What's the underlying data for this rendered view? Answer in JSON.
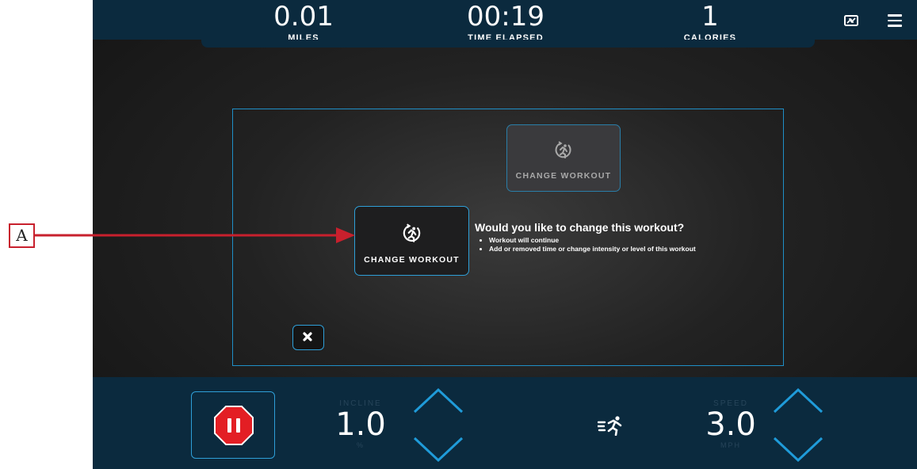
{
  "stats": {
    "miles": {
      "value": "0.01",
      "label": "MILES"
    },
    "time": {
      "value": "00:19",
      "label": "TIME ELAPSED"
    },
    "calories": {
      "value": "1",
      "label": "CALORIES"
    }
  },
  "dialog": {
    "ghost_card_label": "CHANGE WORKOUT",
    "main_card_label": "CHANGE WORKOUT",
    "question_title": "Would you like to change this workout?",
    "bullets": [
      "Workout will continue",
      "Add or removed time or change intensity or level of this workout"
    ]
  },
  "controls": {
    "incline": {
      "label": "INCLINE",
      "value": "1.0",
      "unit": "%"
    },
    "speed": {
      "label": "SPEED",
      "value": "3.0",
      "unit": "MPH"
    }
  },
  "annotation": {
    "label": "A"
  },
  "colors": {
    "panel": "#0b2a3e",
    "accent": "#2e9fd8",
    "stop_red": "#e31e24",
    "callout_red": "#c8202d"
  },
  "icons": [
    "screen-swap-icon",
    "menu-icon",
    "change-workout-icon",
    "close-icon",
    "pause-stop-icon",
    "incline-up-icon",
    "incline-down-icon",
    "running-speed-icon",
    "speed-up-icon",
    "speed-down-icon"
  ]
}
